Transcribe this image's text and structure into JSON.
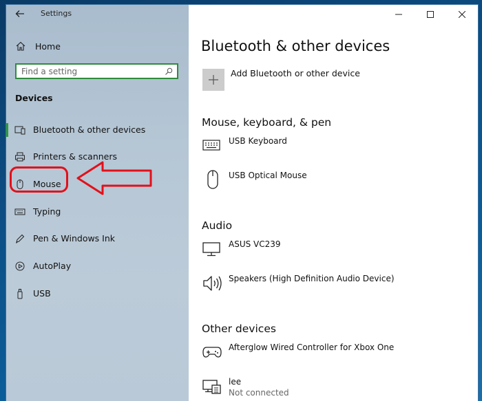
{
  "window": {
    "title": "Settings"
  },
  "sidebar": {
    "home_label": "Home",
    "search_placeholder": "Find a setting",
    "section_title": "Devices",
    "items": [
      {
        "label": "Bluetooth & other devices",
        "icon": "bluetooth-devices-icon",
        "active": true
      },
      {
        "label": "Printers & scanners",
        "icon": "printer-icon",
        "active": false
      },
      {
        "label": "Mouse",
        "icon": "mouse-icon",
        "active": false
      },
      {
        "label": "Typing",
        "icon": "keyboard-icon",
        "active": false
      },
      {
        "label": "Pen & Windows Ink",
        "icon": "pen-icon",
        "active": false
      },
      {
        "label": "AutoPlay",
        "icon": "autoplay-icon",
        "active": false
      },
      {
        "label": "USB",
        "icon": "usb-icon",
        "active": false
      }
    ]
  },
  "main": {
    "title": "Bluetooth & other devices",
    "add_device_label": "Add Bluetooth or other device",
    "groups": [
      {
        "title": "Mouse, keyboard, & pen",
        "devices": [
          {
            "name": "USB Keyboard",
            "icon": "keyboard-icon"
          },
          {
            "name": "USB Optical Mouse",
            "icon": "mouse-icon"
          }
        ]
      },
      {
        "title": "Audio",
        "devices": [
          {
            "name": "ASUS VC239",
            "icon": "monitor-icon"
          },
          {
            "name": "Speakers (High Definition Audio Device)",
            "icon": "speaker-icon"
          }
        ]
      },
      {
        "title": "Other devices",
        "devices": [
          {
            "name": "Afterglow Wired Controller for Xbox One",
            "icon": "gamepad-icon"
          },
          {
            "name": "lee",
            "status": "Not connected",
            "icon": "network-device-icon"
          }
        ]
      }
    ]
  },
  "colors": {
    "accent": "#2e9a3a",
    "annotation": "#e3101a",
    "sidebar_bg": "#b5c6d5"
  }
}
